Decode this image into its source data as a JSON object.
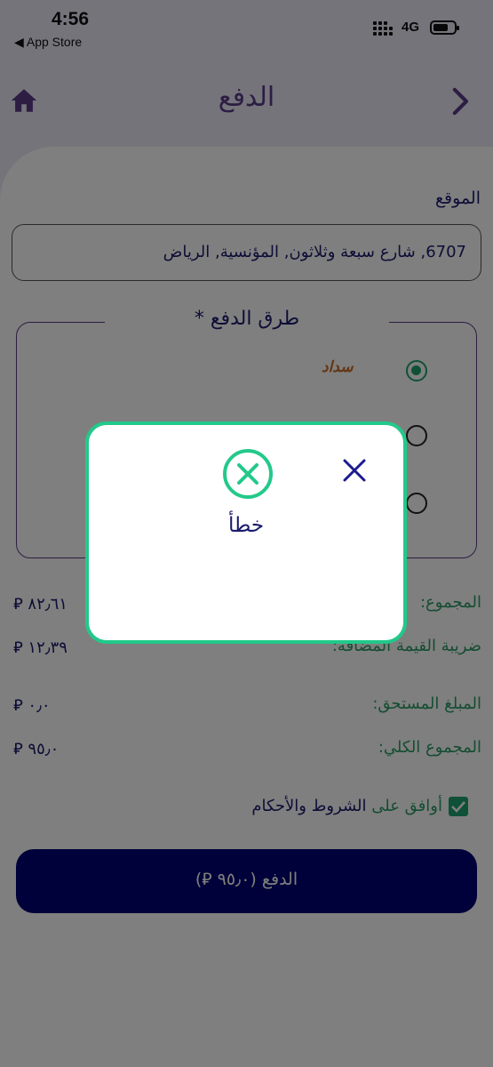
{
  "status_bar": {
    "time": "4:56",
    "back_label": "◀ App Store",
    "network": "4G"
  },
  "header": {
    "title": "الدفع",
    "home_icon": "home-icon",
    "nav_icon": "chevron-right-icon"
  },
  "location": {
    "label": "الموقع",
    "value": "6707, شارع سبعة وثلاثون, المؤنسية, الرياض"
  },
  "payment_methods": {
    "legend": "طرق الدفع *",
    "options": [
      {
        "logo_text": "سداد",
        "selected": true
      },
      {
        "selected": false
      },
      {
        "selected": false
      }
    ]
  },
  "summary": {
    "subtotal_label": "المجموع:",
    "subtotal_value": "٨٢٫٦١ ⃁",
    "vat_label": "ضريبة القيمة المضافة:",
    "vat_value": "١٢٫٣٩ ⃁",
    "due_label": "المبلغ المستحق:",
    "due_value": "٠٫٠ ⃁",
    "total_label": "المجموع الكلي:",
    "total_value": "٩٥٫٠ ⃁"
  },
  "terms": {
    "prefix": "أوافق على ",
    "link": "الشروط والأحكام",
    "checked": true
  },
  "pay_button": {
    "label": "الدفع (٩٥٫٠ ⃁)"
  },
  "dialog": {
    "title": "خطأ",
    "icon": "error-x-circle-icon",
    "close_icon": "close-icon"
  },
  "colors": {
    "navy": "#000075",
    "purple": "#5b3a86",
    "green": "#1ea36e",
    "dialog_border": "#22c98a"
  }
}
